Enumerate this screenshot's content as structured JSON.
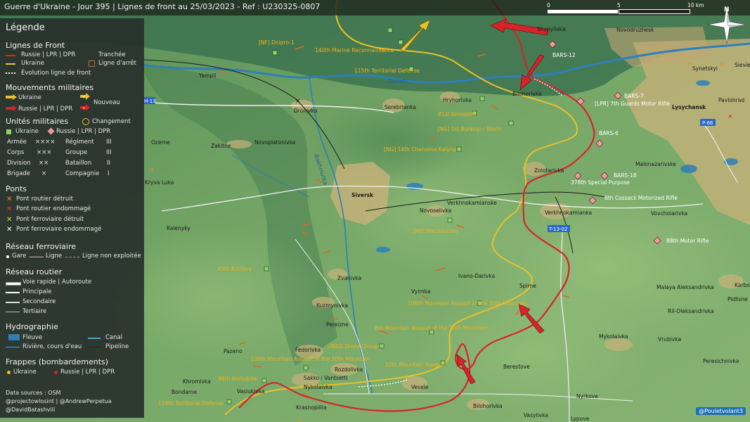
{
  "title": "Guerre d'Ukraine - Jour 395 | Lignes de front au 25/03/2023 - Ref : U230325-0807",
  "scale": {
    "labels": [
      "0",
      "5",
      "10 km"
    ]
  },
  "compass": {
    "label": "N"
  },
  "watermark": "@Pouletvolant3",
  "legend": {
    "title": "Légende",
    "frontlines": {
      "heading": "Lignes de Front",
      "russia": "Russie | LPR | DPR",
      "ukraine": "Ukraine",
      "evolution": "Évolution ligne de front",
      "trench": "Tranchée",
      "stopline": "Ligne d'arrêt"
    },
    "movements": {
      "heading": "Mouvements militaires",
      "ukraine": "Ukraine",
      "russia": "Russie | LPR | DPR",
      "new": "Nouveau"
    },
    "units": {
      "heading": "Unités militaires",
      "ukraine": "Ukraine",
      "russia": "Russie | LPR | DPR",
      "change": "Changement",
      "rows": [
        {
          "name": "Armée",
          "sym": "××××",
          "name2": "Régiment",
          "sym2": "III"
        },
        {
          "name": "Corps",
          "sym": "×××",
          "name2": "Groupe",
          "sym2": "III"
        },
        {
          "name": "Division",
          "sym": "××",
          "name2": "Bataillon",
          "sym2": "II"
        },
        {
          "name": "Brigade",
          "sym": "×",
          "name2": "Compagnie",
          "sym2": "I"
        }
      ]
    },
    "bridges": {
      "heading": "Ponts",
      "items": [
        "Pont routier détruit",
        "Pont routier endommagé",
        "Pont ferroviaire détruit",
        "Pont ferroviaire endommagé"
      ]
    },
    "rail": {
      "heading": "Réseau ferroviaire",
      "station": "Gare",
      "line": "Ligne",
      "unused": "Ligne non exploitée"
    },
    "roads": {
      "heading": "Réseau routier",
      "items": [
        "Voie rapide | Autoroute",
        "Principale",
        "Secondaire",
        "Tertiaire"
      ]
    },
    "hydro": {
      "heading": "Hydrographie",
      "river": "Fleuve",
      "canal": "Canal",
      "stream": "Rivière, cours d'eau",
      "pipeline": "Pipeline"
    },
    "strikes": {
      "heading": "Frappes (bombardements)",
      "ukraine": "Ukraine",
      "russia": "Russie | LPR | DPR"
    },
    "sources": [
      "Data sources : OSM",
      "@projectowlosint | @AndrewPerpetua",
      "@DavidBatashvili"
    ]
  },
  "places": [
    "Shypylivka",
    "Novodruzhesk",
    "Bilohorivka",
    "Lysychansk",
    "Serebrianka",
    "Hryhorivka",
    "Dronivka",
    "Ozerne",
    "Zakitne",
    "Novoplatonivka",
    "Siversk",
    "Kryva Luka",
    "Zolotarivka",
    "Malonazarivske",
    "Verkhnokamianske",
    "Verkhnokamianka",
    "Novoselivka",
    "Kalenyky",
    "Rozdolivka",
    "Ivano-Darivka",
    "Vyimka",
    "Spirne",
    "Zvanivka",
    "Kuzmynivka",
    "Pereizne",
    "Fedorivka",
    "Pazeno",
    "Rozdolivka",
    "Berestove",
    "Khromivka",
    "Vasiukivka",
    "Sakko i Vantsetti",
    "Nykolaivka",
    "Vesele",
    "Krasnopillia",
    "Bilohorivka",
    "Vasylivka",
    "Lypove",
    "Nyrkove",
    "Mykolaivka",
    "Vrubivka",
    "Malaya Aleksandrivka",
    "Ril-Oleksandrivka",
    "Pidlisne",
    "Peresichnivka",
    "Karbonit",
    "Synetskyi",
    "Pavlohrad",
    "Vovchoiarivka",
    "Yampil",
    "Bondarne",
    "Berestove",
    "Novodruzhesk",
    "Sievierodonetsk"
  ],
  "units": {
    "ukraine": [
      "[NF] Dnipro-1",
      "140th Marine Reconnaissance",
      "115th Territorial Defense",
      "81st Airmobile",
      "[NG] 1st Burevyi / Storm",
      "[NG] 14th Chervona Kalyna",
      "54th Mechanized",
      "45th Artillery",
      "108th Mountain Assault of the 10th Mountain",
      "8th Mountain Assault of the 10th Mountain",
      "UNSO Drone Group",
      "109th Mountain Assault of the 10th Mountain",
      "10th Mountain Assault",
      "46th Airmobile",
      "119th Territorial Defense"
    ],
    "russia": [
      "BARS-12",
      "BARS-7",
      "[LPR] 7th Guards Motor Rifle",
      "BARS-6",
      "BARS-18",
      "378th Special Purpose",
      "6th Cossack Motorized Rifle",
      "88th Motor Rifle"
    ]
  },
  "roads": [
    "H-13",
    "P-66",
    "T-13-02"
  ],
  "rivers": [
    "Donets",
    "Bakhmutka"
  ],
  "colors": {
    "russia": "#d8232a",
    "ukraine": "#e7c12d",
    "water": "#2e7fb8"
  }
}
